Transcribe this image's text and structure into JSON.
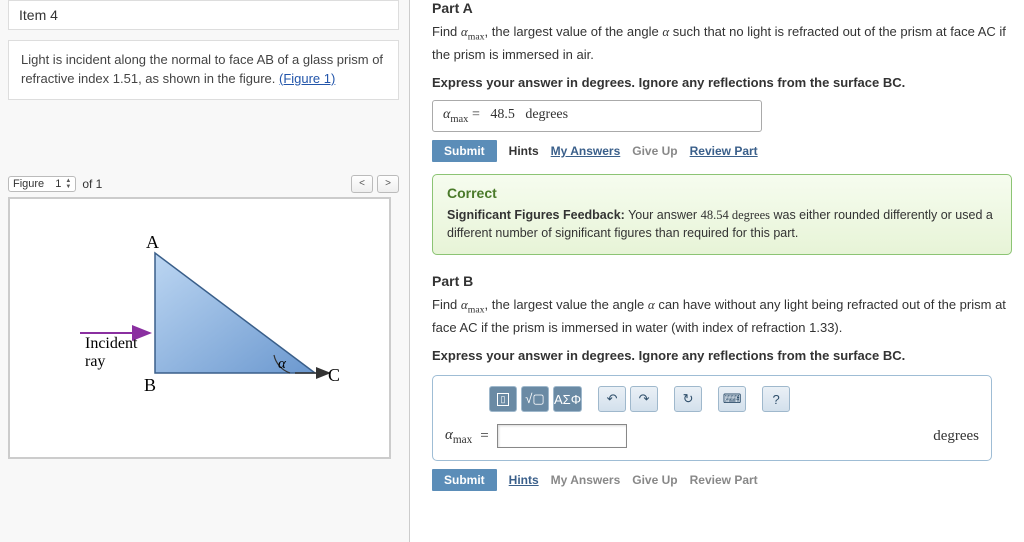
{
  "left": {
    "item_title": "Item 4",
    "statement_1": "Light is incident along the normal to face AB of a glass prism of refractive index 1.51, as shown in the figure. ",
    "statement_link": "(Figure 1)",
    "figure": {
      "label": "Figure",
      "current": "1",
      "of_text": "of 1",
      "vertex_A": "A",
      "vertex_B": "B",
      "vertex_C": "C",
      "angle": "α",
      "incident_l1": "Incident",
      "incident_l2": "ray"
    }
  },
  "right": {
    "partA": {
      "label": "Part A",
      "q1": "Find αmax, the largest value of the angle α such that no light is refracted out of the prism at face AC if the prism is immersed in air.",
      "q2": "Express your answer in degrees. Ignore any reflections from the surface BC.",
      "var_label": "αmax",
      "equals": "=",
      "value": "48.5",
      "units": "degrees",
      "submit": "Submit",
      "hints": "Hints",
      "my_answers": "My Answers",
      "give_up": "Give Up",
      "review": "Review Part",
      "feedback": {
        "correct": "Correct",
        "sig_label": "Significant Figures Feedback:",
        "sig_pre": " Your answer ",
        "sig_val": "48.54 degrees",
        "sig_post": " was either rounded differently or used a different number of significant figures than required for this part."
      }
    },
    "partB": {
      "label": "Part B",
      "q1": "Find αmax, the largest value the angle α can have without any light being refracted out of the prism at face AC if the prism is immersed in water (with index of refraction 1.33).",
      "q2": "Express your answer in degrees. Ignore any reflections from the surface BC.",
      "toolbar": {
        "tpl": "▢",
        "sqrt": "√▢",
        "greek": "ΑΣΦ",
        "undo": "↶",
        "redo": "↷",
        "reset": "↻",
        "keyboard": "⌨",
        "help": "?"
      },
      "var_label": "αmax",
      "equals": "=",
      "answer_value": "",
      "units": "degrees",
      "submit": "Submit",
      "hints": "Hints",
      "my_answers": "My Answers",
      "give_up": "Give Up",
      "review": "Review Part"
    }
  }
}
